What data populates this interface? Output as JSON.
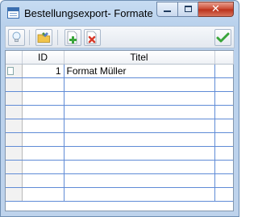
{
  "window": {
    "title": "Bestellungsexport- Formate",
    "minimize_label": "minimize",
    "maximize_label": "maximize",
    "close_label": "✕"
  },
  "toolbar": {
    "buttons": [
      {
        "icon": "lightbulb-icon",
        "label": "hint"
      },
      {
        "icon": "folder-tools-icon",
        "label": "open"
      },
      {
        "icon": "add-document-icon",
        "label": "new"
      },
      {
        "icon": "delete-document-icon",
        "label": "delete"
      },
      {
        "icon": "checkmark-icon",
        "label": "ok"
      }
    ]
  },
  "grid": {
    "columns": [
      "ID",
      "Titel"
    ],
    "rows": [
      {
        "id": "1",
        "titel": "Format Müller"
      }
    ],
    "empty_rows": 9
  },
  "colors": {
    "grid_line": "#5f8bd6",
    "title_bar": "#c7dcf2",
    "accent_green": "#3aa53a",
    "accent_red": "#d83a2a"
  }
}
